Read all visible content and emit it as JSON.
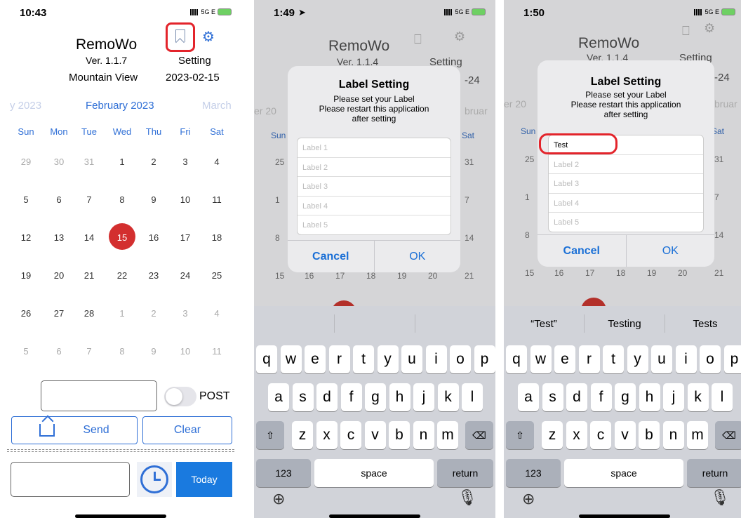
{
  "panel1": {
    "status": {
      "time": "10:43",
      "network": "5G E"
    },
    "app_title": "RemoWo",
    "version": "Ver. 1.1.7",
    "location": "Mountain View",
    "setting_label": "Setting",
    "date": "2023-02-15",
    "months": {
      "prev": "y 2023",
      "current": "February 2023",
      "next": "March"
    },
    "weekdays": [
      "Sun",
      "Mon",
      "Tue",
      "Wed",
      "Thu",
      "Fri",
      "Sat"
    ],
    "weeks": [
      [
        "29",
        "30",
        "31",
        "1",
        "2",
        "3",
        "4"
      ],
      [
        "5",
        "6",
        "7",
        "8",
        "9",
        "10",
        "11"
      ],
      [
        "12",
        "13",
        "14",
        "15",
        "16",
        "17",
        "18"
      ],
      [
        "19",
        "20",
        "21",
        "22",
        "23",
        "24",
        "25"
      ],
      [
        "26",
        "27",
        "28",
        "1",
        "2",
        "3",
        "4"
      ],
      [
        "5",
        "6",
        "7",
        "8",
        "9",
        "10",
        "11"
      ]
    ],
    "post_label": "POST",
    "send_label": "Send",
    "clear_label": "Clear",
    "today_label": "Today",
    "accent": "#2f6fd6",
    "today_color": "#d32f2f"
  },
  "panel2": {
    "status": {
      "time": "1:49",
      "network": "5G E"
    },
    "bg": {
      "title": "RemoWo",
      "version": "Ver. 1.1.4",
      "setting": "Setting",
      "date_frag": "-24",
      "month_left": "er 20",
      "month_right": "bruar",
      "sun": "Sun",
      "sat": "Sat",
      "left_col": [
        "25",
        "1",
        "8",
        "15"
      ],
      "right_col": [
        "31",
        "7",
        "14",
        "21"
      ],
      "bottom_row": [
        "16",
        "17",
        "18",
        "19",
        "20"
      ]
    },
    "dialog": {
      "title": "Label Setting",
      "message": [
        "Please set your Label",
        "Please restart this application",
        "after setting"
      ],
      "fields": [
        "Label 1",
        "Label 2",
        "Label 3",
        "Label 4",
        "Label 5"
      ],
      "cancel": "Cancel",
      "ok": "OK"
    },
    "keyboard": {
      "row1": [
        "q",
        "w",
        "e",
        "r",
        "t",
        "y",
        "u",
        "i",
        "o",
        "p"
      ],
      "row2": [
        "a",
        "s",
        "d",
        "f",
        "g",
        "h",
        "j",
        "k",
        "l"
      ],
      "row3": [
        "z",
        "x",
        "c",
        "v",
        "b",
        "n",
        "m"
      ],
      "num": "123",
      "space": "space",
      "return": "return"
    }
  },
  "panel3": {
    "status": {
      "time": "1:50",
      "network": "5G E"
    },
    "bg": {
      "title": "RemoWo",
      "version": "Ver. 1.1.4",
      "setting": "Setting",
      "date_frag": "-24",
      "month_left": "er 20",
      "month_right": "bruar",
      "sun": "Sun",
      "sat": "Sat",
      "left_col": [
        "25",
        "1",
        "8",
        "15"
      ],
      "right_col": [
        "31",
        "7",
        "14",
        "21"
      ],
      "bottom_row": [
        "16",
        "17",
        "18",
        "19",
        "20"
      ]
    },
    "dialog": {
      "title": "Label Setting",
      "message": [
        "Please set your Label",
        "Please restart this application",
        "after setting"
      ],
      "fields": [
        "Test",
        "Label 2",
        "Label 3",
        "Label 4",
        "Label 5"
      ],
      "cancel": "Cancel",
      "ok": "OK"
    },
    "suggestions": [
      "“Test”",
      "Testing",
      "Tests"
    ],
    "keyboard": {
      "row1": [
        "q",
        "w",
        "e",
        "r",
        "t",
        "y",
        "u",
        "i",
        "o",
        "p"
      ],
      "row2": [
        "a",
        "s",
        "d",
        "f",
        "g",
        "h",
        "j",
        "k",
        "l"
      ],
      "row3": [
        "z",
        "x",
        "c",
        "v",
        "b",
        "n",
        "m"
      ],
      "num": "123",
      "space": "space",
      "return": "return"
    }
  }
}
